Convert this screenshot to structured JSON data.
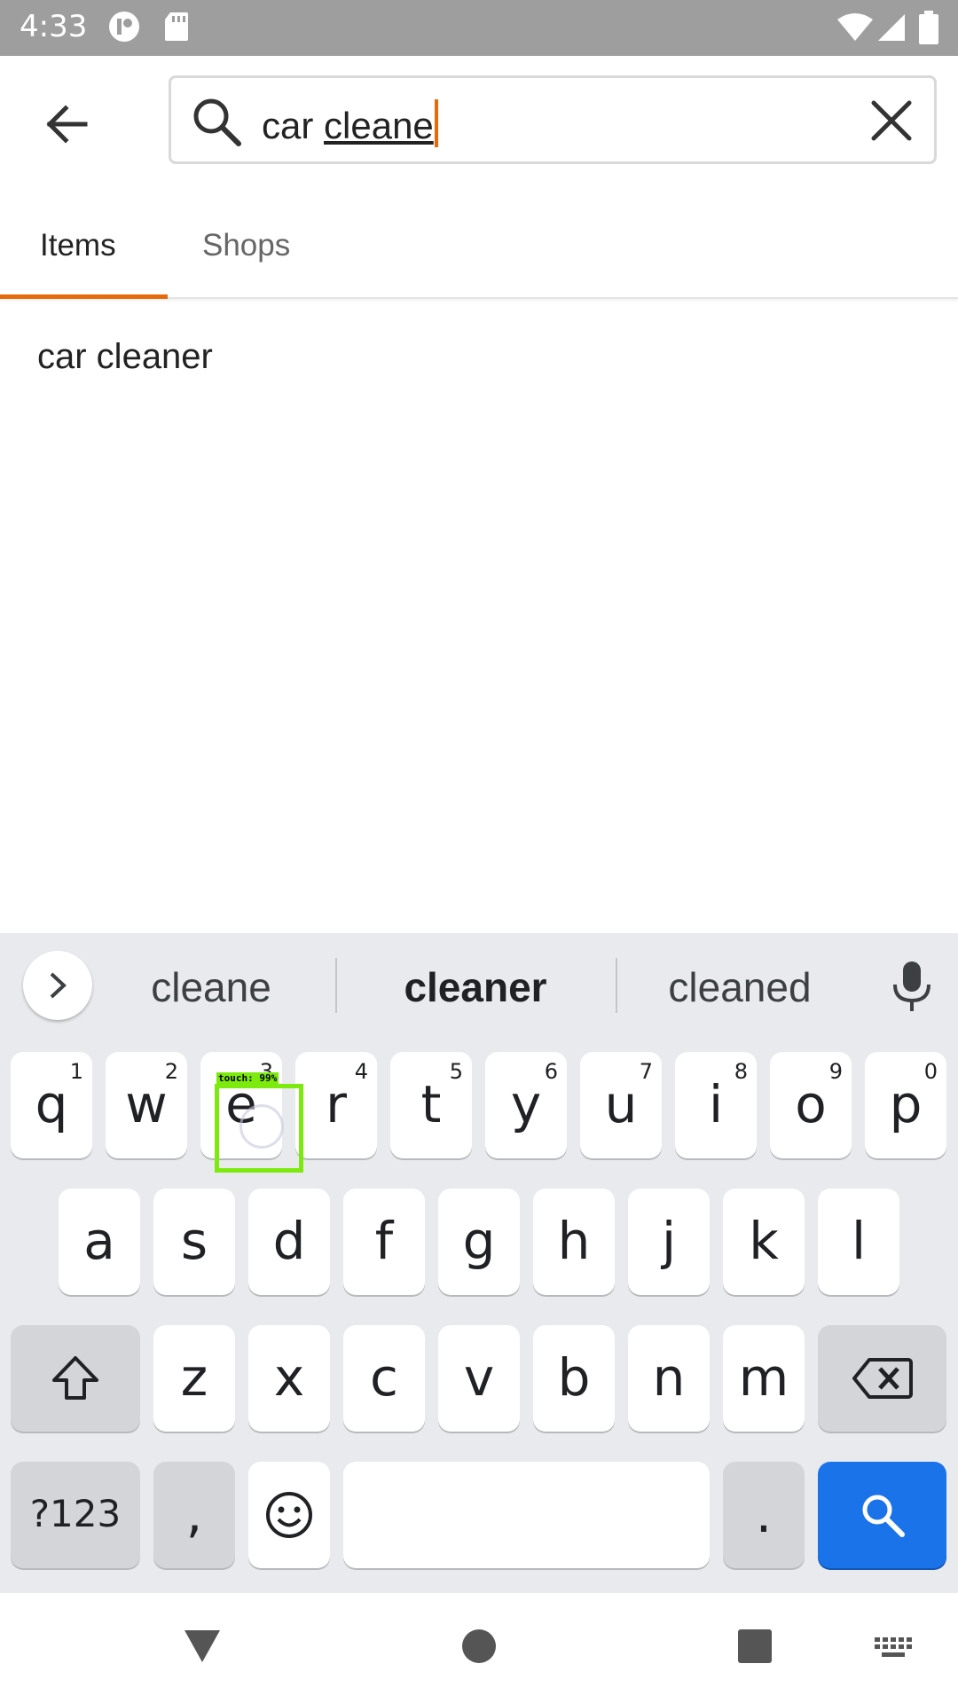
{
  "status": {
    "time": "4:33"
  },
  "search": {
    "text_plain": "car ",
    "text_underlined": "cleane"
  },
  "tabs": [
    {
      "label": "Items"
    },
    {
      "label": "Shops"
    }
  ],
  "suggestions_list": [
    "car cleaner"
  ],
  "keyboard": {
    "suggestions": [
      "cleane",
      "cleaner",
      "cleaned"
    ],
    "row1": [
      {
        "k": "q",
        "n": "1"
      },
      {
        "k": "w",
        "n": "2"
      },
      {
        "k": "e",
        "n": "3"
      },
      {
        "k": "r",
        "n": "4"
      },
      {
        "k": "t",
        "n": "5"
      },
      {
        "k": "y",
        "n": "6"
      },
      {
        "k": "u",
        "n": "7"
      },
      {
        "k": "i",
        "n": "8"
      },
      {
        "k": "o",
        "n": "9"
      },
      {
        "k": "p",
        "n": "0"
      }
    ],
    "row2": [
      "a",
      "s",
      "d",
      "f",
      "g",
      "h",
      "j",
      "k",
      "l"
    ],
    "row3": [
      "z",
      "x",
      "c",
      "v",
      "b",
      "n",
      "m"
    ],
    "symbols_label": "?123",
    "comma_label": ",",
    "period_label": "."
  },
  "touch_overlay": {
    "label": "touch: 99%"
  },
  "colors": {
    "accent": "#e8690a",
    "key_action": "#1a73e8",
    "touch_box": "#7dea0e"
  }
}
